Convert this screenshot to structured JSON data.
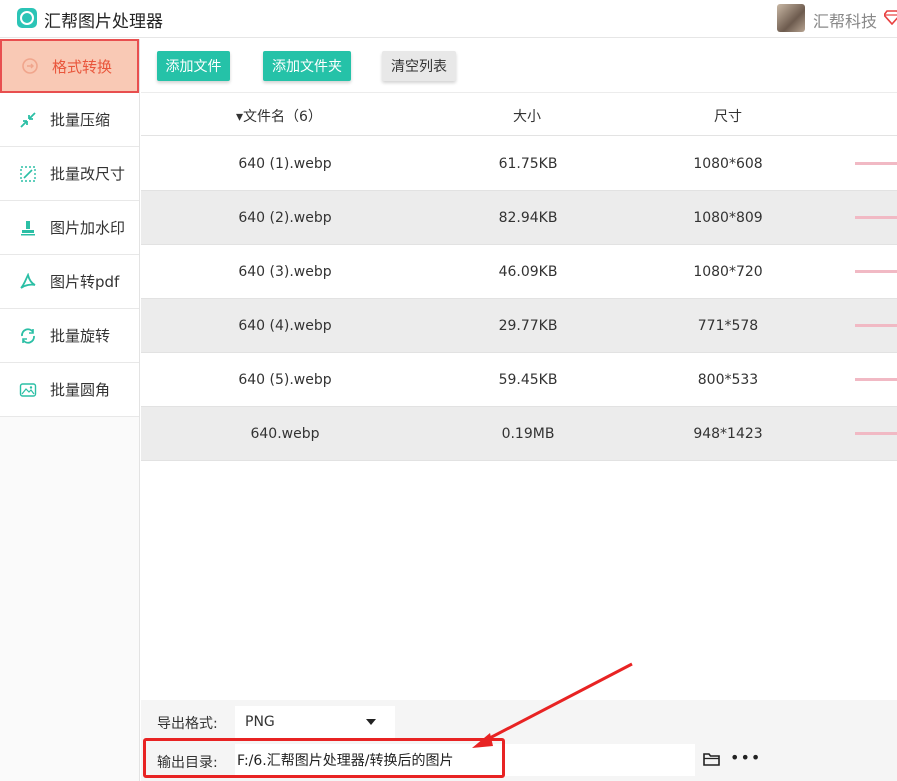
{
  "app": {
    "title": "汇帮图片处理器",
    "user_name": "汇帮科技"
  },
  "sidebar": {
    "items": [
      {
        "label": "格式转换",
        "icon": "format-convert-icon",
        "active": true
      },
      {
        "label": "批量压缩",
        "icon": "compress-icon",
        "active": false
      },
      {
        "label": "批量改尺寸",
        "icon": "resize-icon",
        "active": false
      },
      {
        "label": "图片加水印",
        "icon": "watermark-icon",
        "active": false
      },
      {
        "label": "图片转pdf",
        "icon": "pdf-icon",
        "active": false
      },
      {
        "label": "批量旋转",
        "icon": "rotate-icon",
        "active": false
      },
      {
        "label": "批量圆角",
        "icon": "rounded-corner-icon",
        "active": false
      }
    ]
  },
  "toolbar": {
    "add_file": "添加文件",
    "add_folder": "添加文件夹",
    "clear_list": "清空列表"
  },
  "table": {
    "headers": {
      "name": "▾文件名（6）",
      "size": "大小",
      "dims": "尺寸"
    },
    "rows": [
      {
        "name": "640 (1).webp",
        "size": "61.75KB",
        "dims": "1080*608"
      },
      {
        "name": "640 (2).webp",
        "size": "82.94KB",
        "dims": "1080*809"
      },
      {
        "name": "640 (3).webp",
        "size": "46.09KB",
        "dims": "1080*720"
      },
      {
        "name": "640 (4).webp",
        "size": "29.77KB",
        "dims": "771*578"
      },
      {
        "name": "640 (5).webp",
        "size": "59.45KB",
        "dims": "800*533"
      },
      {
        "name": "640.webp",
        "size": "0.19MB",
        "dims": "948*1423"
      }
    ]
  },
  "output": {
    "format_label": "导出格式:",
    "format_value": "PNG",
    "dir_label": "输出目录:",
    "dir_value": "F:/6.汇帮图片处理器/转换后的图片"
  },
  "colors": {
    "accent": "#25c2a8",
    "active_bg": "#f9c9b5",
    "active_text": "#e9563c",
    "highlight": "#e82323",
    "row_alt": "#ececec"
  }
}
